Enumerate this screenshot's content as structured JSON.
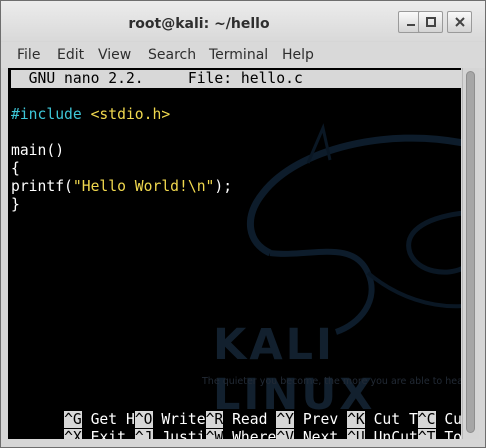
{
  "window": {
    "title": "root@kali: ~/hello"
  },
  "window_controls": [
    "minimize-icon",
    "maximize-icon",
    "close-icon"
  ],
  "menu": [
    "File",
    "Edit",
    "View",
    "Search",
    "Terminal",
    "Help"
  ],
  "nano": {
    "header": "  GNU nano 2.2.     File: hello.c",
    "code": {
      "include_directive": "#include",
      "include_header": "<stdio.h>",
      "main_line": "main()",
      "open_brace": "{",
      "printf_prefix": "printf(",
      "printf_string": "\"Hello World!\\n\"",
      "printf_suffix": ");",
      "close_brace": "}"
    },
    "shortcuts_row1": [
      {
        "key": "^G",
        "label": " Get H"
      },
      {
        "key": "^O",
        "label": " Write"
      },
      {
        "key": "^R",
        "label": " Read "
      },
      {
        "key": "^Y",
        "label": " Prev "
      },
      {
        "key": "^K",
        "label": " Cut T"
      },
      {
        "key": "^C",
        "label": " Cur Pos"
      }
    ],
    "shortcuts_row2": [
      {
        "key": "^X",
        "label": " Exit "
      },
      {
        "key": "^J",
        "label": " Justi"
      },
      {
        "key": "^W",
        "label": " Where"
      },
      {
        "key": "^V",
        "label": " Next "
      },
      {
        "key": "^U",
        "label": " UnCut"
      },
      {
        "key": "^T",
        "label": " To Spel"
      }
    ]
  },
  "wallpaper": {
    "brand": "KALI LINUX",
    "slogan": "The quieter you become, the more you are able to hear"
  }
}
